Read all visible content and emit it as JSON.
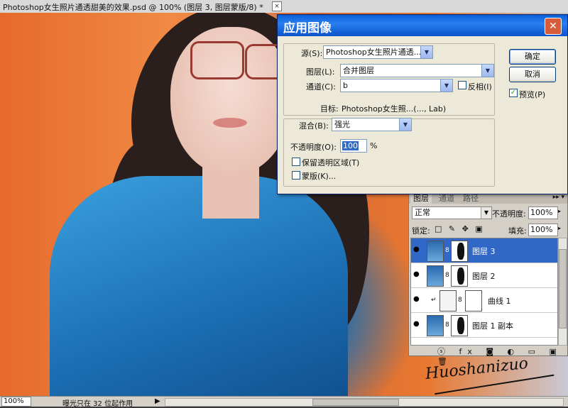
{
  "document": {
    "title": "Photoshop女生照片通透甜美的效果.psd @ 100% (图层 3, 图层蒙版/8) *",
    "close_glyph": "×"
  },
  "status_bar": {
    "zoom": "100%",
    "message": "曝光只在 32 位起作用",
    "arrow_glyph": "▶"
  },
  "dialog": {
    "title": "应用图像",
    "close_glyph": "✕",
    "source_label": "源(S):",
    "source_value": "Photoshop女生照片通透...",
    "layer_label": "图层(L):",
    "layer_value": "合并图层",
    "channel_label": "通道(C):",
    "channel_value": "b",
    "invert_label": "反相(I)",
    "invert_checked": false,
    "target_label": "目标:",
    "target_value": "Photoshop女生照...(..., Lab)",
    "blending_label": "混合(B):",
    "blending_value": "强光",
    "opacity_label": "不透明度(O):",
    "opacity_value": "100",
    "opacity_unit": "%",
    "preserve_label": "保留透明区域(T)",
    "preserve_checked": false,
    "mask_label": "蒙版(K)...",
    "mask_checked": false,
    "ok_label": "确定",
    "cancel_label": "取消",
    "preview_label": "预览(P)",
    "preview_checked": true,
    "dropdown_glyph": "▼"
  },
  "layers_panel": {
    "tabs": [
      "图层",
      "通道",
      "路径"
    ],
    "active_tab": 0,
    "menu_glyph": "▸▸ ▾",
    "blend_mode": "正常",
    "opacity_label": "不透明度:",
    "opacity_value": "100%",
    "lock_label": "锁定:",
    "lock_icons": "□ ✎ ✥ ▣",
    "fill_label": "填充:",
    "fill_value": "100%",
    "arrow_glyph": "▸",
    "dropdown_glyph": "▼",
    "eye_glyph": "●",
    "chain_glyph": "8",
    "clip_glyph": "↵",
    "layers": [
      {
        "name": "图层 3",
        "selected": true,
        "type": "photo-mask"
      },
      {
        "name": "图层 2",
        "selected": false,
        "type": "photo-mask"
      },
      {
        "name": "曲线 1",
        "selected": false,
        "type": "adjustment"
      },
      {
        "name": "图层 1 副本",
        "selected": false,
        "type": "photo-mask"
      }
    ],
    "bottom_icons": "ⓢ fx ◙ ◐ ▭ ▣ 🗑"
  },
  "signature": "Huoshanizuo"
}
